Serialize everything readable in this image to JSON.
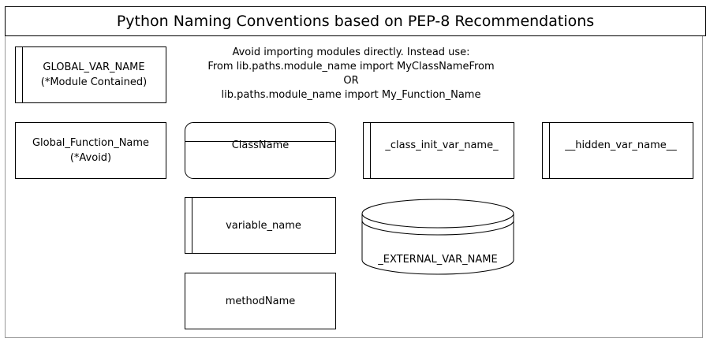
{
  "diagram": {
    "title": "Python Naming Conventions based on PEP-8 Recommendations",
    "note_lines": [
      "Avoid importing modules directly. Instead use:",
      "From lib.paths.module_name import MyClassNameFrom",
      "OR",
      "lib.paths.module_name import My_Function_Name"
    ],
    "shapes": {
      "global_var": {
        "line1": "GLOBAL_VAR_NAME",
        "line2": "(*Module Contained)"
      },
      "global_function": {
        "line1": "Global_Function_Name",
        "line2": "(*Avoid)"
      },
      "class_name": "ClassName",
      "class_init_var": "_class_init_var_name_",
      "hidden_var": "__hidden_var_name__",
      "variable_name": "variable_name",
      "external_var": "_EXTERNAL_VAR_NAME",
      "method_name": "methodName"
    }
  }
}
